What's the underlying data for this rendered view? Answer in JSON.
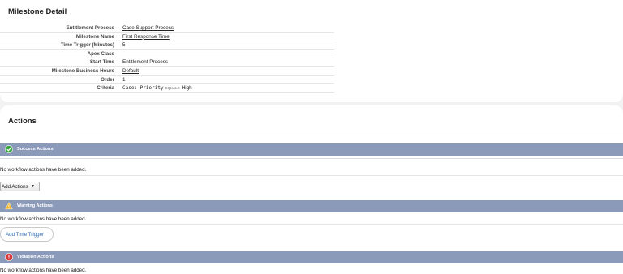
{
  "detail": {
    "title": "Milestone Detail",
    "rows": [
      {
        "label": "Entitlement Process",
        "value": "Case Support Process"
      },
      {
        "label": "Milestone Name",
        "value": "First Response Time"
      },
      {
        "label": "Time Trigger (Minutes)",
        "value": "5"
      },
      {
        "label": "Apex Class",
        "value": ""
      },
      {
        "label": "Start Time",
        "value": "Entitlement Process"
      },
      {
        "label": "Milestone Business Hours",
        "value": "Default"
      },
      {
        "label": "Order",
        "value": "1"
      },
      {
        "label": "Criteria",
        "field": "Case: Priority",
        "operator": "EQUALS",
        "operand": "High"
      }
    ]
  },
  "actions": {
    "title": "Actions",
    "success": {
      "label": "Success Actions",
      "empty": "No workflow actions have been added.",
      "button": "Add Actions",
      "button_caret": "▼"
    },
    "warning": {
      "label": "Warning Actions",
      "empty": "No workflow actions have been added.",
      "button": "Add Time Trigger"
    },
    "violation": {
      "label": "Violation Actions",
      "empty": "No workflow actions have been added."
    }
  },
  "colors": {
    "band": "#8a9ab8",
    "success_icon": "#3aa63f",
    "warning_icon": "#f5b21a",
    "violation_icon": "#d83a3a"
  }
}
